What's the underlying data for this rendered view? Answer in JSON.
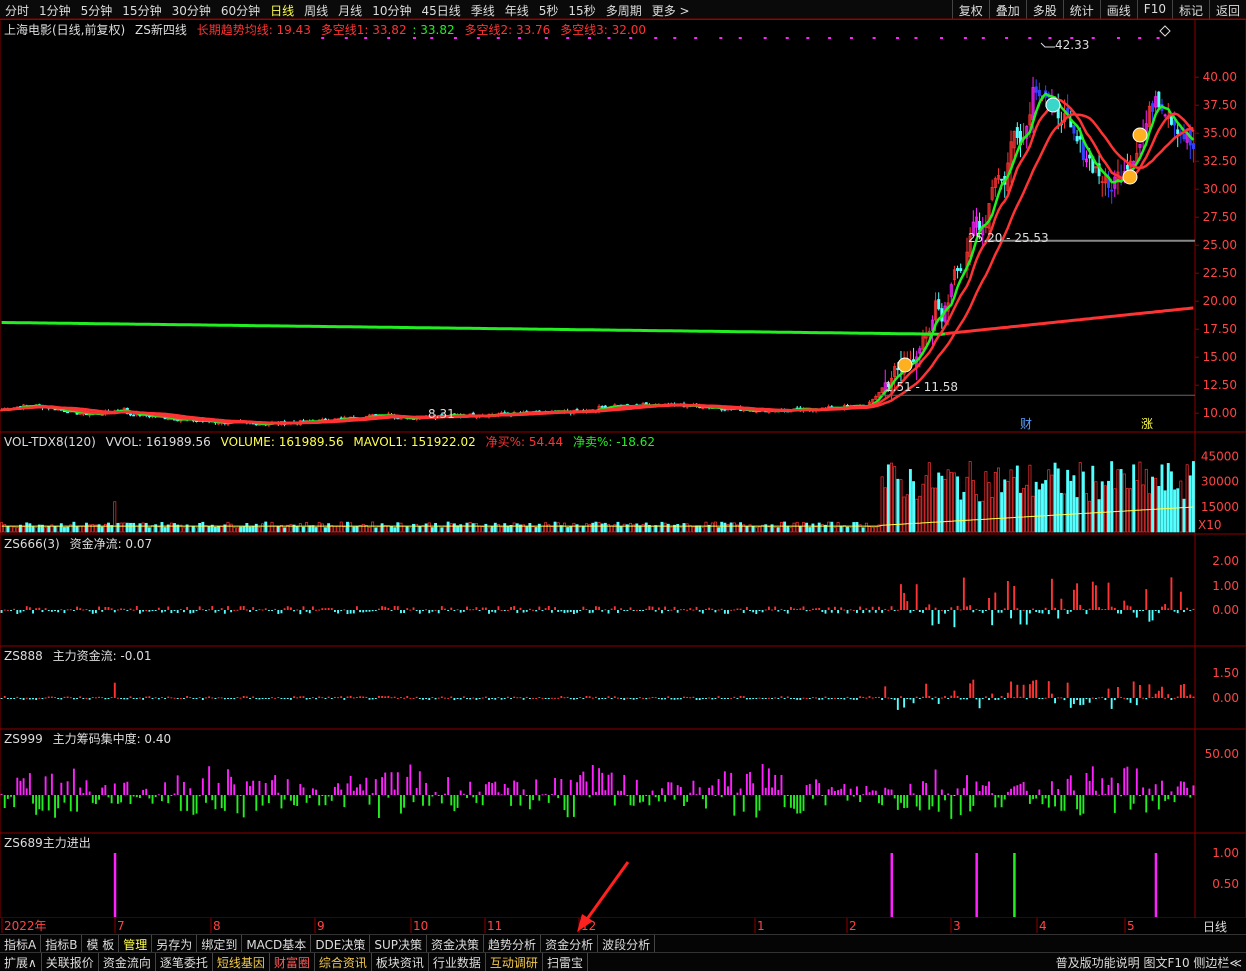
{
  "toolbar": {
    "periods": [
      "分时",
      "1分钟",
      "5分钟",
      "15分钟",
      "30分钟",
      "60分钟",
      "日线",
      "周线",
      "月线",
      "10分钟",
      "45日线",
      "季线",
      "年线",
      "5秒",
      "15秒",
      "多周期",
      "更多 >"
    ],
    "active": "日线",
    "right": [
      "复权",
      "叠加",
      "多股",
      "统计",
      "画线",
      "F10",
      "标记",
      "返回"
    ]
  },
  "main": {
    "stock": "上海电影(日线,前复权)",
    "indicator": "ZS新四线",
    "long_ma": "长期趋势均线: 19.43",
    "line1": "多空线1: 33.82",
    "val2": ": 33.82",
    "line2": "多空线2: 33.76",
    "line3": "多空线3: 32.00",
    "high_label": "42.33",
    "low_label": "8.31",
    "range1": "25.20 - 25.53",
    "range2": "1.51 - 11.58",
    "marker_cai": "财",
    "marker_zhang": "涨"
  },
  "vol": {
    "name": "VOL-TDX8(120)",
    "vvol": "VVOL: 161989.56",
    "volume": "VOLUME: 161989.56",
    "mavol": "MAVOL1: 151922.02",
    "buy": "净买%: 54.44",
    "sell": "净卖%: -18.62",
    "x10": "X10"
  },
  "zs666": {
    "name": "ZS666(3)",
    "label": "资金净流: 0.07"
  },
  "zs888": {
    "name": "ZS888",
    "label": "主力资金流: -0.01"
  },
  "zs999": {
    "name": "ZS999",
    "label": "主力筹码集中度: 0.40"
  },
  "zs689": {
    "name": "ZS689主力进出"
  },
  "axis": {
    "main_ticks": [
      "40.00",
      "37.50",
      "35.00",
      "32.50",
      "30.00",
      "27.50",
      "25.00",
      "22.50",
      "20.00",
      "17.50",
      "15.00",
      "12.50",
      "10.00"
    ],
    "vol_ticks": [
      "45000",
      "30000",
      "15000"
    ],
    "zs666_ticks": [
      "2.00",
      "1.00",
      "0.00"
    ],
    "zs888_ticks": [
      "1.50",
      "0.00"
    ],
    "zs999_ticks": [
      "50.00"
    ],
    "zs689_ticks": [
      "1.00",
      "0.50"
    ]
  },
  "dates": [
    "2022年",
    "7",
    "8",
    "9",
    "10",
    "11",
    "12",
    "1",
    "2",
    "3",
    "4",
    "5",
    "6"
  ],
  "period_label": "日线",
  "tabs1": [
    "指标A",
    "指标B",
    "模 板",
    "管理",
    "另存为",
    "绑定到",
    "MACD基本",
    "DDE决策",
    "SUP决策",
    "资金决策",
    "趋势分析",
    "资金分析",
    "波段分析"
  ],
  "tabs1_active": "管理",
  "tabs2": [
    "扩展∧",
    "关联报价",
    "资金流向",
    "逐笔委托",
    "短线基因",
    "财富圈",
    "综合资讯",
    "板块资讯",
    "行业数据",
    "互动调研",
    "扫雷宝"
  ],
  "bottom_right": "普及版功能说明 图文F10 侧边栏≪",
  "colors": {
    "up": "#ff3333",
    "down": "#54ffff",
    "green": "#22ee22",
    "magenta": "#ff22ff",
    "yellow": "#ffff4d"
  },
  "chart_data": {
    "type": "candlestick",
    "title": "上海电影(日线,前复权)",
    "ylim": [
      8.5,
      43.5
    ],
    "annotations": {
      "high": 42.33,
      "low": 8.31
    },
    "ma_last": {
      "long": 19.43,
      "l1": 33.82,
      "l2": 33.76,
      "l3": 32.0
    },
    "volume_last": 161989.56,
    "mavol_last": 151922.02
  }
}
